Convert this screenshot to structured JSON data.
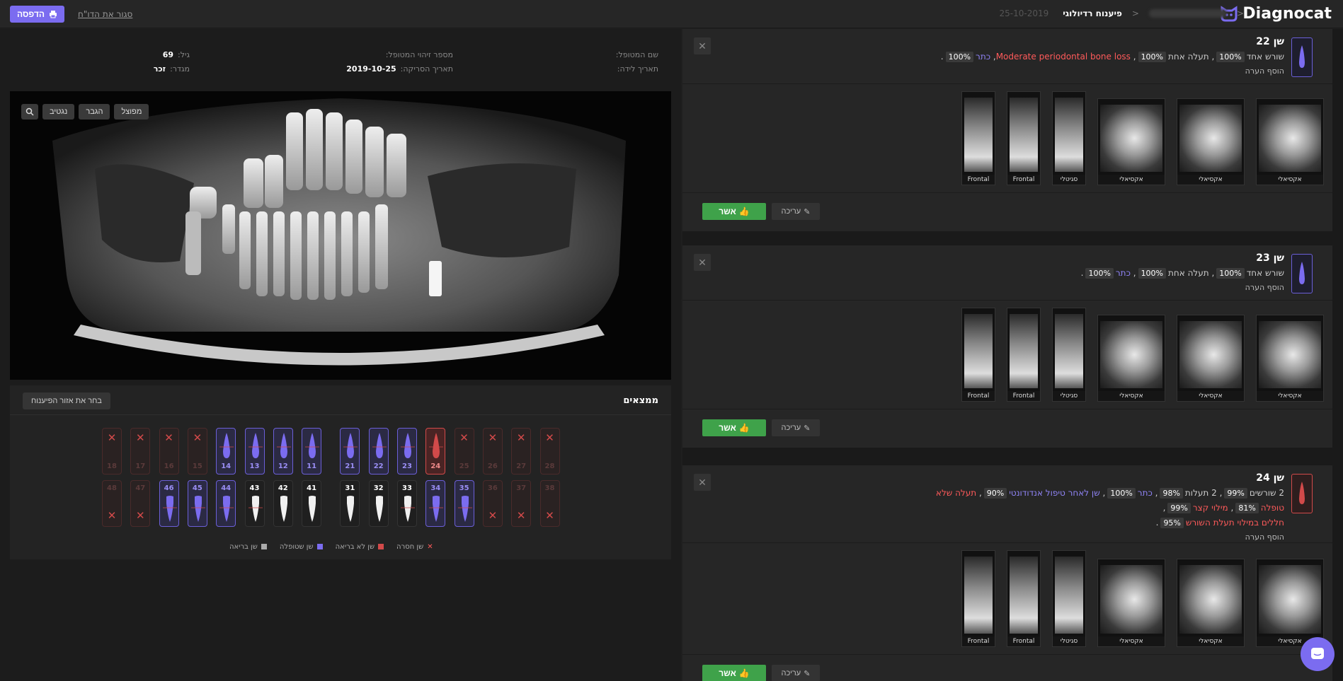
{
  "brand": {
    "name": "Diagnocat"
  },
  "breadcrumb": {
    "sep1": "<",
    "sep2": "<",
    "title": "פיענוח רדיולוגי",
    "date": "25-10-2019"
  },
  "toolbar": {
    "print_label": "הדפסה",
    "close_report_label": "סגור את הדו\"ח"
  },
  "patient": {
    "name_label": "שם המטופל:",
    "name_value": "",
    "id_label": "מספר זיהוי המטופל:",
    "id_value": "",
    "age_label": "גיל:",
    "age_value": "69",
    "dob_label": "תאריך לידה:",
    "dob_value": "",
    "scan_label": "תאריך הסריקה:",
    "scan_value": "2019-10-25",
    "gender_label": "מגדר:",
    "gender_value": "זכר"
  },
  "xray": {
    "btn_segmented": "מפוצל",
    "btn_enlarge": "הגבר",
    "btn_negative": "נגטיב"
  },
  "findings": {
    "title": "ממצאים",
    "select_area": "בחר את אזור הפיענוח",
    "upper": [
      {
        "n": "18",
        "s": "missing"
      },
      {
        "n": "17",
        "s": "missing"
      },
      {
        "n": "16",
        "s": "missing"
      },
      {
        "n": "15",
        "s": "missing"
      },
      {
        "n": "14",
        "s": "treated"
      },
      {
        "n": "13",
        "s": "treated"
      },
      {
        "n": "12",
        "s": "treated"
      },
      {
        "n": "11",
        "s": "treated"
      },
      {
        "n": "21",
        "s": "treated"
      },
      {
        "n": "22",
        "s": "treated"
      },
      {
        "n": "23",
        "s": "treated"
      },
      {
        "n": "24",
        "s": "unhealthy"
      },
      {
        "n": "25",
        "s": "missing"
      },
      {
        "n": "26",
        "s": "missing"
      },
      {
        "n": "27",
        "s": "missing"
      },
      {
        "n": "28",
        "s": "missing"
      }
    ],
    "lower": [
      {
        "n": "48",
        "s": "missing"
      },
      {
        "n": "47",
        "s": "missing"
      },
      {
        "n": "46",
        "s": "treated"
      },
      {
        "n": "45",
        "s": "treated"
      },
      {
        "n": "44",
        "s": "treated"
      },
      {
        "n": "43",
        "s": "healthy"
      },
      {
        "n": "42",
        "s": "healthy"
      },
      {
        "n": "41",
        "s": "healthy"
      },
      {
        "n": "31",
        "s": "healthy"
      },
      {
        "n": "32",
        "s": "healthy"
      },
      {
        "n": "33",
        "s": "healthy"
      },
      {
        "n": "34",
        "s": "treated"
      },
      {
        "n": "35",
        "s": "treated"
      },
      {
        "n": "36",
        "s": "missing"
      },
      {
        "n": "37",
        "s": "missing"
      },
      {
        "n": "38",
        "s": "missing"
      }
    ],
    "legend": {
      "missing": "שן חסרה",
      "unhealthy": "שן לא בריאה",
      "treated": "שן שטופלה",
      "healthy": "שן בריאה"
    }
  },
  "cards": [
    {
      "title": "שן 22",
      "line1": [
        {
          "t": "שורש אחד"
        },
        {
          "p": "100%"
        },
        {
          "t": ", תעלה אחת"
        },
        {
          "p": "100%"
        },
        {
          "t": ", "
        },
        {
          "r": "Moderate periodontal bone loss"
        },
        {
          "t": ", "
        },
        {
          "b": "כתר"
        },
        {
          "p": "100%"
        },
        {
          "t": "."
        }
      ],
      "line2": [],
      "add_note": "הוסף הערה",
      "slices": [
        "אקסיאלי",
        "אקסיאלי",
        "אקסיאלי",
        "סגיטלי",
        "Frontal",
        "Frontal"
      ],
      "approve": "אשר",
      "edit": "עריכה"
    },
    {
      "title": "שן 23",
      "line1": [
        {
          "t": "שורש אחד"
        },
        {
          "p": "100%"
        },
        {
          "t": ", תעלה אחת"
        },
        {
          "p": "100%"
        },
        {
          "t": ", "
        },
        {
          "b": "כתר"
        },
        {
          "p": "100%"
        },
        {
          "t": "."
        }
      ],
      "line2": [],
      "add_note": "הוסף הערה",
      "slices": [
        "אקסיאלי",
        "אקסיאלי",
        "אקסיאלי",
        "סגיטלי",
        "Frontal",
        "Frontal"
      ],
      "approve": "אשר",
      "edit": "עריכה"
    },
    {
      "title": "שן 24",
      "line1": [
        {
          "t": "2 שורשים"
        },
        {
          "p": "99%"
        },
        {
          "t": ", 2 תעלות"
        },
        {
          "p": "98%"
        },
        {
          "t": ", "
        },
        {
          "b": "כתר"
        },
        {
          "p": "100%"
        },
        {
          "t": ", "
        },
        {
          "b": "שן לאחר טיפול אנדודונטי"
        },
        {
          "p": "90%"
        },
        {
          "t": ", "
        },
        {
          "r": "תעלה שלא טופלה"
        },
        {
          "p": "81%"
        },
        {
          "t": ", "
        },
        {
          "r": "מילוי קצר"
        },
        {
          "p": "99%"
        },
        {
          "t": ","
        }
      ],
      "line2": [
        {
          "r": "חללים במילוי תעלת השורש"
        },
        {
          "p": "95%"
        },
        {
          "t": "."
        }
      ],
      "add_note": "הוסף הערה",
      "slices": [
        "אקסיאלי",
        "אקסיאלי",
        "אקסיאלי",
        "סגיטלי",
        "Frontal",
        "Frontal"
      ],
      "approve": "אשר",
      "edit": "עריכה"
    }
  ],
  "colors": {
    "accent": "#7b6cf0",
    "approve": "#3fa24a",
    "danger": "#ff5a5a",
    "treated": "#8f83f5"
  }
}
